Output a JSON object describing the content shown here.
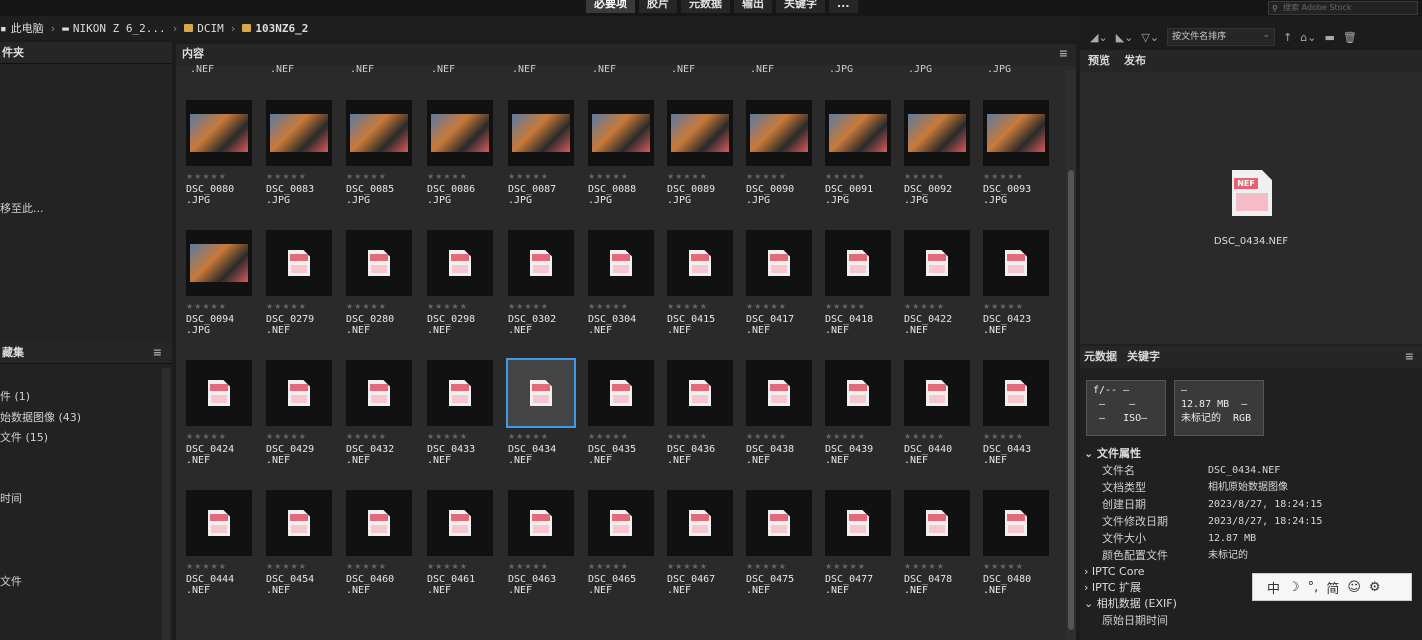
{
  "workspace_tabs": [
    "必要项",
    "胶片",
    "元数据",
    "输出",
    "关键字",
    "..."
  ],
  "search_placeholder": "搜索 Adobe Stock",
  "breadcrumb": [
    "此电脑",
    "NIKON Z 6_2...",
    "DCIM",
    "103NZ6_2"
  ],
  "sort_label": "按文件名排序",
  "left_panel": {
    "folders_title": "件夹",
    "drag_hint": "移至此...",
    "collections_title": "藏集",
    "filters": [
      "件 (1)",
      "始数据图像 (43)",
      "文件 (15)"
    ],
    "time_label": "时间",
    "file_label": "文件"
  },
  "content_title": "内容",
  "top_partial_names": [
    ".NEF",
    ".NEF",
    ".NEF",
    ".NEF",
    ".NEF",
    ".NEF",
    ".NEF",
    ".NEF",
    ".JPG",
    ".JPG",
    ".JPG"
  ],
  "grid_rows": [
    [
      {
        "name": "DSC_0080",
        "ext": ".JPG",
        "type": "jpg"
      },
      {
        "name": "DSC_0083",
        "ext": ".JPG",
        "type": "jpg"
      },
      {
        "name": "DSC_0085",
        "ext": ".JPG",
        "type": "jpg"
      },
      {
        "name": "DSC_0086",
        "ext": ".JPG",
        "type": "jpg"
      },
      {
        "name": "DSC_0087",
        "ext": ".JPG",
        "type": "jpg"
      },
      {
        "name": "DSC_0088",
        "ext": ".JPG",
        "type": "jpg"
      },
      {
        "name": "DSC_0089",
        "ext": ".JPG",
        "type": "jpg"
      },
      {
        "name": "DSC_0090",
        "ext": ".JPG",
        "type": "jpg"
      },
      {
        "name": "DSC_0091",
        "ext": ".JPG",
        "type": "jpg"
      },
      {
        "name": "DSC_0092",
        "ext": ".JPG",
        "type": "jpg"
      },
      {
        "name": "DSC_0093",
        "ext": ".JPG",
        "type": "jpg"
      }
    ],
    [
      {
        "name": "DSC_0094",
        "ext": ".JPG",
        "type": "jpg"
      },
      {
        "name": "DSC_0279",
        "ext": ".NEF",
        "type": "nef"
      },
      {
        "name": "DSC_0280",
        "ext": ".NEF",
        "type": "nef"
      },
      {
        "name": "DSC_0298",
        "ext": ".NEF",
        "type": "nef"
      },
      {
        "name": "DSC_0302",
        "ext": ".NEF",
        "type": "nef"
      },
      {
        "name": "DSC_0304",
        "ext": ".NEF",
        "type": "nef"
      },
      {
        "name": "DSC_0415",
        "ext": ".NEF",
        "type": "nef"
      },
      {
        "name": "DSC_0417",
        "ext": ".NEF",
        "type": "nef"
      },
      {
        "name": "DSC_0418",
        "ext": ".NEF",
        "type": "nef"
      },
      {
        "name": "DSC_0422",
        "ext": ".NEF",
        "type": "nef"
      },
      {
        "name": "DSC_0423",
        "ext": ".NEF",
        "type": "nef"
      }
    ],
    [
      {
        "name": "DSC_0424",
        "ext": ".NEF",
        "type": "nef"
      },
      {
        "name": "DSC_0429",
        "ext": ".NEF",
        "type": "nef"
      },
      {
        "name": "DSC_0432",
        "ext": ".NEF",
        "type": "nef"
      },
      {
        "name": "DSC_0433",
        "ext": ".NEF",
        "type": "nef"
      },
      {
        "name": "DSC_0434",
        "ext": ".NEF",
        "type": "nef",
        "selected": true
      },
      {
        "name": "DSC_0435",
        "ext": ".NEF",
        "type": "nef"
      },
      {
        "name": "DSC_0436",
        "ext": ".NEF",
        "type": "nef"
      },
      {
        "name": "DSC_0438",
        "ext": ".NEF",
        "type": "nef"
      },
      {
        "name": "DSC_0439",
        "ext": ".NEF",
        "type": "nef"
      },
      {
        "name": "DSC_0440",
        "ext": ".NEF",
        "type": "nef"
      },
      {
        "name": "DSC_0443",
        "ext": ".NEF",
        "type": "nef"
      }
    ],
    [
      {
        "name": "DSC_0444",
        "ext": ".NEF",
        "type": "nef"
      },
      {
        "name": "DSC_0454",
        "ext": ".NEF",
        "type": "nef"
      },
      {
        "name": "DSC_0460",
        "ext": ".NEF",
        "type": "nef"
      },
      {
        "name": "DSC_0461",
        "ext": ".NEF",
        "type": "nef"
      },
      {
        "name": "DSC_0463",
        "ext": ".NEF",
        "type": "nef"
      },
      {
        "name": "DSC_0465",
        "ext": ".NEF",
        "type": "nef"
      },
      {
        "name": "DSC_0467",
        "ext": ".NEF",
        "type": "nef"
      },
      {
        "name": "DSC_0475",
        "ext": ".NEF",
        "type": "nef"
      },
      {
        "name": "DSC_0477",
        "ext": ".NEF",
        "type": "nef"
      },
      {
        "name": "DSC_0478",
        "ext": ".NEF",
        "type": "nef"
      },
      {
        "name": "DSC_0480",
        "ext": ".NEF",
        "type": "nef"
      }
    ]
  ],
  "right_panel": {
    "preview_tabs": [
      "预览",
      "发布"
    ],
    "preview_filename": "DSC_0434.NEF",
    "badge": "NEF",
    "meta_tabs": [
      "元数据",
      "关键字"
    ],
    "exif_box": "f/-- —\n —    —\n —   ISO—",
    "info_box": "—\n12.87 MB  —\n未标记的  RGB",
    "file_props_title": "文件属性",
    "file_props": [
      {
        "k": "文件名",
        "v": "DSC_0434.NEF"
      },
      {
        "k": "文档类型",
        "v": "相机原始数据图像"
      },
      {
        "k": "创建日期",
        "v": "2023/8/27, 18:24:15"
      },
      {
        "k": "文件修改日期",
        "v": "2023/8/27, 18:24:15"
      },
      {
        "k": "文件大小",
        "v": "12.87 MB"
      },
      {
        "k": "颜色配置文件",
        "v": "未标记的"
      }
    ],
    "iptc_core": "IPTC Core",
    "iptc_ext": "IPTC 扩展",
    "camera_data": "相机数据 (EXIF)",
    "orig_date": "原始日期时间"
  },
  "ime_bar": [
    "中",
    "☽",
    "°,",
    "简",
    "☺",
    "⚙"
  ],
  "colors": {
    "accent": "#3d9be9",
    "nef_red": "#e36470",
    "folder": "#d9a64c"
  }
}
